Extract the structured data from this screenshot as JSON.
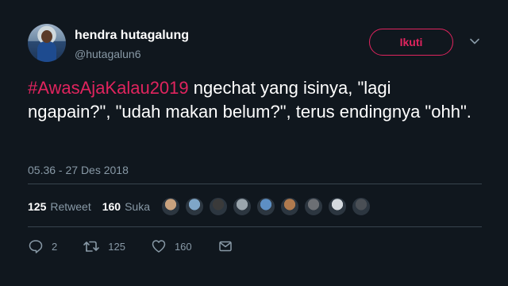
{
  "user": {
    "name": "hendra hutagalung",
    "handle": "@hutagalun6"
  },
  "follow_label": "Ikuti",
  "tweet": {
    "hashtag": "#AwasAjaKalau2019",
    "text": " ngechat yang isinya, \"lagi ngapain?\", \"udah makan belum?\", terus endingnya \"ohh\"."
  },
  "timestamp": "05.36 - 27 Des 2018",
  "stats": {
    "retweets": "125",
    "retweets_label": "Retweet",
    "likes": "160",
    "likes_label": "Suka"
  },
  "likers": [
    {
      "color": "#c9a27e"
    },
    {
      "color": "#7fa6c8"
    },
    {
      "color": "#3a3a3a"
    },
    {
      "color": "#9aa5ad"
    },
    {
      "color": "#5d8fc4"
    },
    {
      "color": "#b07a4e"
    },
    {
      "color": "#6c6f74"
    },
    {
      "color": "#d4d9de"
    },
    {
      "color": "#4a4f55"
    }
  ],
  "actions": {
    "replies": "2",
    "retweets": "125",
    "likes": "160"
  },
  "colors": {
    "background": "#10171e",
    "accent": "#e0245e",
    "muted": "#8899a6",
    "divider": "#38444d"
  },
  "icons": [
    "reply-icon",
    "retweet-icon",
    "like-icon",
    "dm-icon",
    "chevron-down-icon"
  ]
}
